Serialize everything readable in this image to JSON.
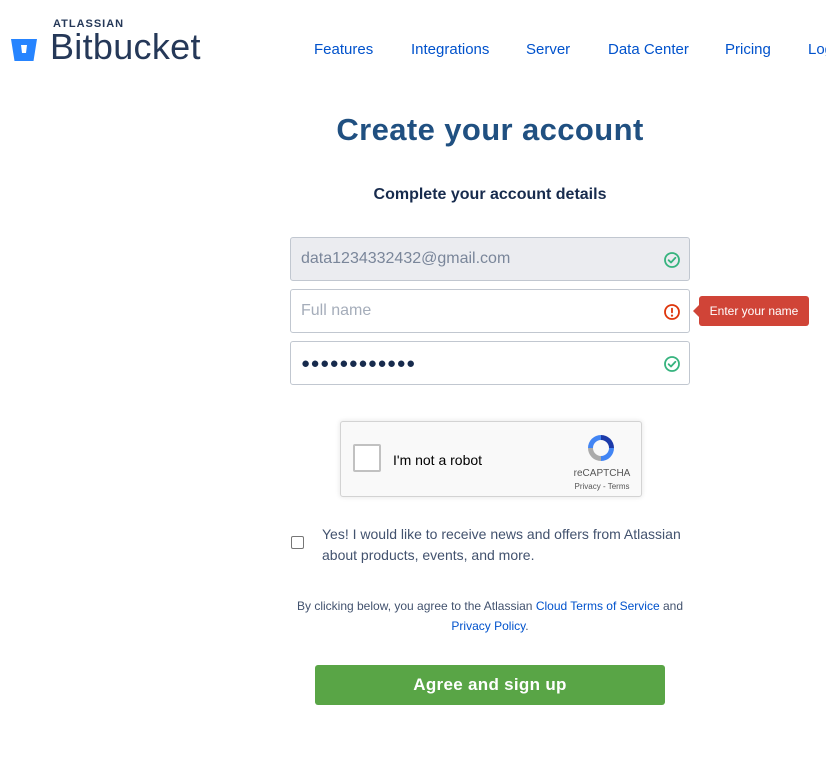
{
  "brand": {
    "company": "ATLASSIAN",
    "product": "Bitbucket",
    "logo_icon": "bitbucket-bucket-icon",
    "color": "#2684ff"
  },
  "nav": {
    "items": [
      {
        "label": "Features"
      },
      {
        "label": "Integrations"
      },
      {
        "label": "Server"
      },
      {
        "label": "Data Center"
      },
      {
        "label": "Pricing"
      },
      {
        "label": "Log in"
      }
    ]
  },
  "form": {
    "title": "Create your account",
    "subtitle": "Complete your account details",
    "email": {
      "value": "data1234332432@gmail.com",
      "status": "valid",
      "status_icon": "check-circle-icon"
    },
    "full_name": {
      "value": "",
      "placeholder": "Full name",
      "status": "error",
      "status_icon": "error-circle-icon",
      "error": "Enter your name"
    },
    "password": {
      "masked_value": "●●●●●●●●●●●●",
      "status": "valid",
      "status_icon": "check-circle-icon"
    },
    "captcha": {
      "label": "I'm not a robot",
      "brand": "reCAPTCHA",
      "links": "Privacy - Terms",
      "checked": false
    },
    "marketing": {
      "label": "Yes! I would like to receive news and offers from Atlassian about products, events, and more.",
      "checked": false
    },
    "legal": {
      "prefix": "By clicking below, you agree to the Atlassian",
      "tos_link": "Cloud Terms of Service",
      "conjunction": "and",
      "privacy_link": "Privacy Policy",
      "suffix": "."
    },
    "submit_label": "Agree and sign up"
  },
  "colors": {
    "title": "#205081",
    "link": "#0052cc",
    "valid": "#36b37e",
    "error": "#de350b",
    "tooltip_bg": "#d04437",
    "submit_bg": "#59a546"
  }
}
